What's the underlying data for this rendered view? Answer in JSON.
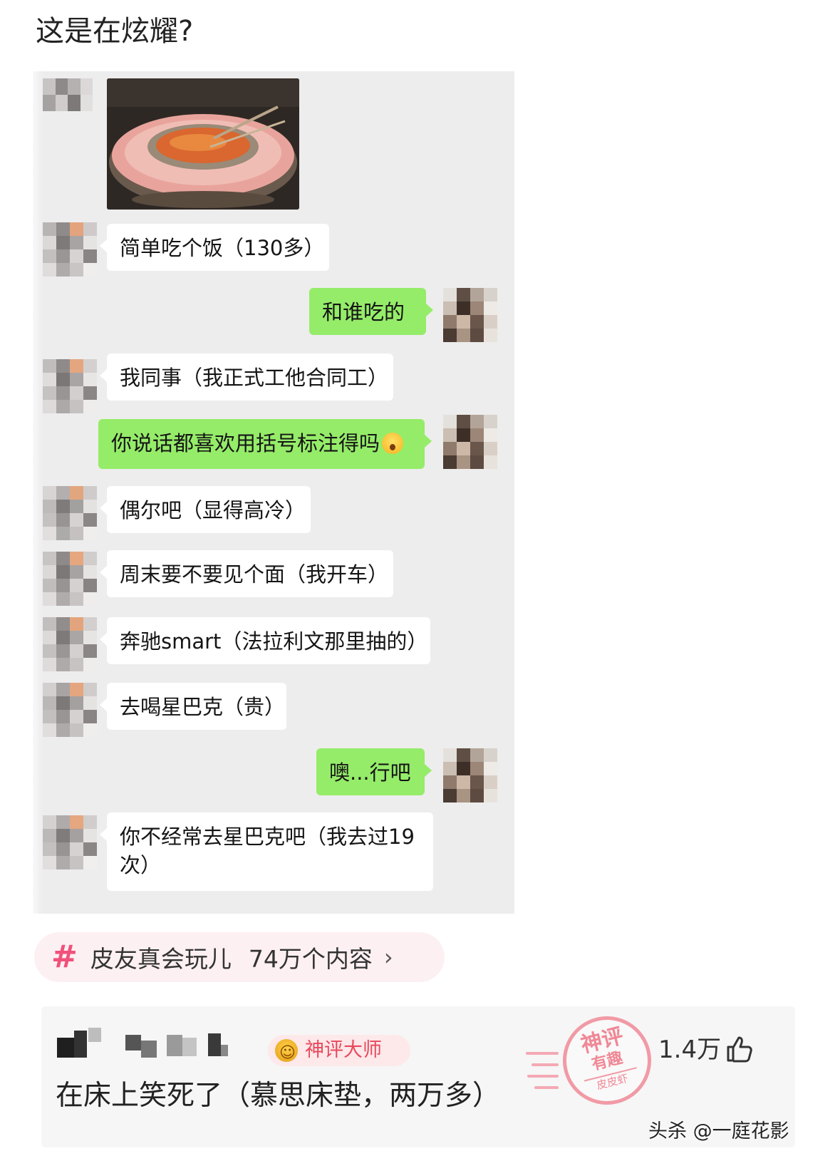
{
  "post": {
    "title": "这是在炫耀?"
  },
  "chat": {
    "messages": [
      {
        "side": "in",
        "text": "简单吃个饭（130多）"
      },
      {
        "side": "out",
        "text": "和谁吃的"
      },
      {
        "side": "in",
        "text": "我同事（我正式工他合同工）"
      },
      {
        "side": "out",
        "text": "你说话都喜欢用括号标注得吗"
      },
      {
        "side": "in",
        "text": "偶尔吧（显得高冷）"
      },
      {
        "side": "in",
        "text": "周末要不要见个面（我开车）"
      },
      {
        "side": "in",
        "text": "奔驰smart（法拉利文那里抽的）"
      },
      {
        "side": "in",
        "text": "去喝星巴克（贵）"
      },
      {
        "side": "out",
        "text": "噢...行吧"
      },
      {
        "side": "in",
        "text": "你不经常去星巴克吧（我去过19次）"
      }
    ],
    "emoji_name": "scream-emoji-icon"
  },
  "topic": {
    "symbol": "#",
    "name": "皮友真会玩儿",
    "count": "74万个内容",
    "chevron": "›"
  },
  "comment": {
    "badge": "神评大师",
    "text": "在床上笑死了（慕思床垫，两万多）",
    "likes": "1.4万",
    "stamp": {
      "line1": "神评",
      "line2": "有趣",
      "line3": "皮皮虾"
    }
  },
  "watermark": "头杀 @一庭花影",
  "colors": {
    "bubble_out": "#95ec69",
    "bubble_in": "#ffffff",
    "chat_bg": "#ededed",
    "topic_accent": "#f0517a",
    "badge_text": "#e8495b",
    "stamp": "#f19aa6"
  }
}
